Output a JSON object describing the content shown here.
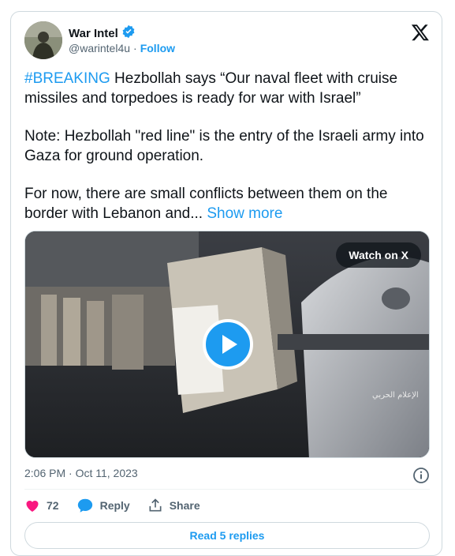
{
  "author": {
    "display_name": "War Intel",
    "handle": "@warintel4u",
    "separator": "·",
    "follow_label": "Follow"
  },
  "tweet": {
    "hashtag": "#BREAKING",
    "line1_rest": " Hezbollah says “Our naval fleet with cruise missiles and torpedoes is ready for war with Israel”",
    "para2": "Note: Hezbollah \"red line\" is the entry of the Israeli army into Gaza for ground operation.",
    "para3": "For now, there are small conflicts between them on the border with Lebanon and...",
    "show_more": "Show more"
  },
  "media": {
    "watch_label": "Watch on X",
    "overlay_text": "الإعلام الحربي"
  },
  "timestamp": "2:06 PM · Oct 11, 2023",
  "actions": {
    "like_count": "72",
    "reply_label": "Reply",
    "share_label": "Share"
  },
  "replies_button": "Read 5 replies",
  "colors": {
    "accent": "#1d9bf0",
    "like": "#f91880",
    "text": "#0f1419",
    "muted": "#536471"
  },
  "icons": [
    "verified-badge-icon",
    "x-logo-icon",
    "play-icon",
    "info-icon",
    "heart-icon",
    "reply-bubble-icon",
    "share-icon"
  ]
}
